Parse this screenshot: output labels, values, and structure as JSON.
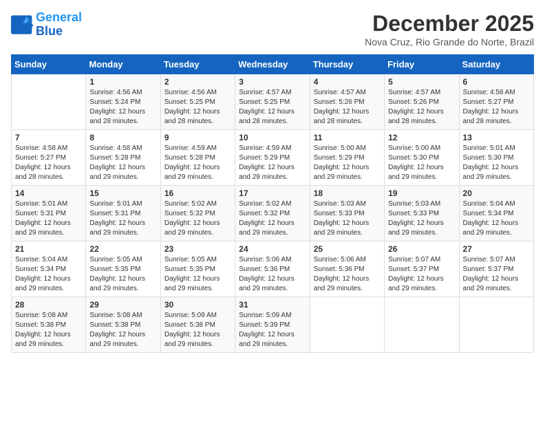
{
  "header": {
    "logo_line1": "General",
    "logo_line2": "Blue",
    "month": "December 2025",
    "location": "Nova Cruz, Rio Grande do Norte, Brazil"
  },
  "weekdays": [
    "Sunday",
    "Monday",
    "Tuesday",
    "Wednesday",
    "Thursday",
    "Friday",
    "Saturday"
  ],
  "weeks": [
    [
      {
        "day": "",
        "sunrise": "",
        "sunset": "",
        "daylight": ""
      },
      {
        "day": "1",
        "sunrise": "4:56 AM",
        "sunset": "5:24 PM",
        "daylight": "12 hours and 28 minutes."
      },
      {
        "day": "2",
        "sunrise": "4:56 AM",
        "sunset": "5:25 PM",
        "daylight": "12 hours and 28 minutes."
      },
      {
        "day": "3",
        "sunrise": "4:57 AM",
        "sunset": "5:25 PM",
        "daylight": "12 hours and 28 minutes."
      },
      {
        "day": "4",
        "sunrise": "4:57 AM",
        "sunset": "5:26 PM",
        "daylight": "12 hours and 28 minutes."
      },
      {
        "day": "5",
        "sunrise": "4:57 AM",
        "sunset": "5:26 PM",
        "daylight": "12 hours and 28 minutes."
      },
      {
        "day": "6",
        "sunrise": "4:58 AM",
        "sunset": "5:27 PM",
        "daylight": "12 hours and 28 minutes."
      }
    ],
    [
      {
        "day": "7",
        "sunrise": "4:58 AM",
        "sunset": "5:27 PM",
        "daylight": "12 hours and 28 minutes."
      },
      {
        "day": "8",
        "sunrise": "4:58 AM",
        "sunset": "5:28 PM",
        "daylight": "12 hours and 29 minutes."
      },
      {
        "day": "9",
        "sunrise": "4:59 AM",
        "sunset": "5:28 PM",
        "daylight": "12 hours and 29 minutes."
      },
      {
        "day": "10",
        "sunrise": "4:59 AM",
        "sunset": "5:29 PM",
        "daylight": "12 hours and 29 minutes."
      },
      {
        "day": "11",
        "sunrise": "5:00 AM",
        "sunset": "5:29 PM",
        "daylight": "12 hours and 29 minutes."
      },
      {
        "day": "12",
        "sunrise": "5:00 AM",
        "sunset": "5:30 PM",
        "daylight": "12 hours and 29 minutes."
      },
      {
        "day": "13",
        "sunrise": "5:01 AM",
        "sunset": "5:30 PM",
        "daylight": "12 hours and 29 minutes."
      }
    ],
    [
      {
        "day": "14",
        "sunrise": "5:01 AM",
        "sunset": "5:31 PM",
        "daylight": "12 hours and 29 minutes."
      },
      {
        "day": "15",
        "sunrise": "5:01 AM",
        "sunset": "5:31 PM",
        "daylight": "12 hours and 29 minutes."
      },
      {
        "day": "16",
        "sunrise": "5:02 AM",
        "sunset": "5:32 PM",
        "daylight": "12 hours and 29 minutes."
      },
      {
        "day": "17",
        "sunrise": "5:02 AM",
        "sunset": "5:32 PM",
        "daylight": "12 hours and 29 minutes."
      },
      {
        "day": "18",
        "sunrise": "5:03 AM",
        "sunset": "5:33 PM",
        "daylight": "12 hours and 29 minutes."
      },
      {
        "day": "19",
        "sunrise": "5:03 AM",
        "sunset": "5:33 PM",
        "daylight": "12 hours and 29 minutes."
      },
      {
        "day": "20",
        "sunrise": "5:04 AM",
        "sunset": "5:34 PM",
        "daylight": "12 hours and 29 minutes."
      }
    ],
    [
      {
        "day": "21",
        "sunrise": "5:04 AM",
        "sunset": "5:34 PM",
        "daylight": "12 hours and 29 minutes."
      },
      {
        "day": "22",
        "sunrise": "5:05 AM",
        "sunset": "5:35 PM",
        "daylight": "12 hours and 29 minutes."
      },
      {
        "day": "23",
        "sunrise": "5:05 AM",
        "sunset": "5:35 PM",
        "daylight": "12 hours and 29 minutes."
      },
      {
        "day": "24",
        "sunrise": "5:06 AM",
        "sunset": "5:36 PM",
        "daylight": "12 hours and 29 minutes."
      },
      {
        "day": "25",
        "sunrise": "5:06 AM",
        "sunset": "5:36 PM",
        "daylight": "12 hours and 29 minutes."
      },
      {
        "day": "26",
        "sunrise": "5:07 AM",
        "sunset": "5:37 PM",
        "daylight": "12 hours and 29 minutes."
      },
      {
        "day": "27",
        "sunrise": "5:07 AM",
        "sunset": "5:37 PM",
        "daylight": "12 hours and 29 minutes."
      }
    ],
    [
      {
        "day": "28",
        "sunrise": "5:08 AM",
        "sunset": "5:38 PM",
        "daylight": "12 hours and 29 minutes."
      },
      {
        "day": "29",
        "sunrise": "5:08 AM",
        "sunset": "5:38 PM",
        "daylight": "12 hours and 29 minutes."
      },
      {
        "day": "30",
        "sunrise": "5:09 AM",
        "sunset": "5:38 PM",
        "daylight": "12 hours and 29 minutes."
      },
      {
        "day": "31",
        "sunrise": "5:09 AM",
        "sunset": "5:39 PM",
        "daylight": "12 hours and 29 minutes."
      },
      {
        "day": "",
        "sunrise": "",
        "sunset": "",
        "daylight": ""
      },
      {
        "day": "",
        "sunrise": "",
        "sunset": "",
        "daylight": ""
      },
      {
        "day": "",
        "sunrise": "",
        "sunset": "",
        "daylight": ""
      }
    ]
  ]
}
